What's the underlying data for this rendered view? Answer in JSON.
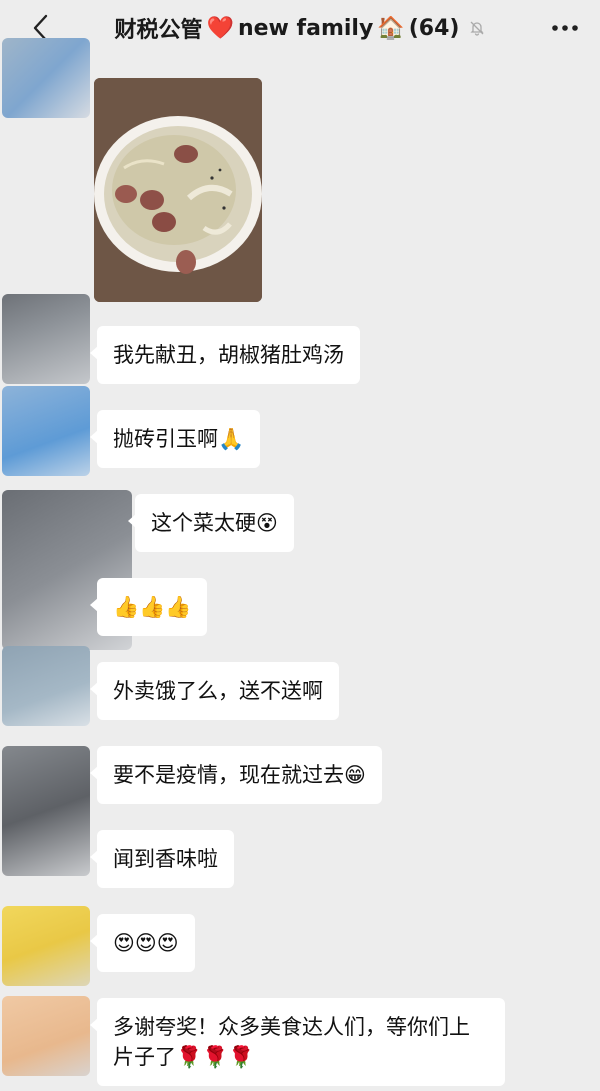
{
  "header": {
    "back_icon": "chevron-left-icon",
    "title_text": "财税公管",
    "heart": "❤️",
    "family_text": "new family",
    "house": "🏠",
    "count": "(64)",
    "mute_icon": "bell-off-icon",
    "more_label": "•••"
  },
  "messages": [
    {
      "text": "我先献丑，胡椒猪肚鸡汤"
    },
    {
      "text": "抛砖引玉啊🙏"
    },
    {
      "text": "这个菜太硬😵"
    },
    {
      "text": "👍👍👍"
    },
    {
      "text": "外卖饿了么，送不送啊"
    },
    {
      "text": "要不是疫情，现在就过去😁"
    },
    {
      "text": "闻到香味啦"
    },
    {
      "text": "😍😍😍"
    },
    {
      "text": "多谢夸奖！众多美食达人们，等你们上片子了🌹🌹🌹"
    }
  ],
  "colors": {
    "background": "#ededed",
    "bubble": "#ffffff"
  }
}
